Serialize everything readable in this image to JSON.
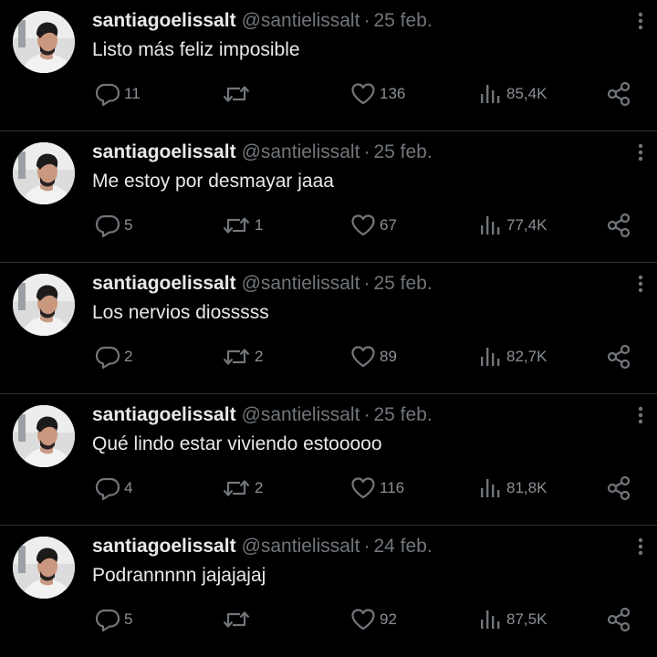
{
  "tweets": [
    {
      "name": "santiagoelissalt",
      "handle": "@santielissalt",
      "separator": "·",
      "date": "25 feb.",
      "text": "Listo más feliz imposible",
      "replies": "11",
      "retweets": "",
      "likes": "136",
      "views": "85,4K"
    },
    {
      "name": "santiagoelissalt",
      "handle": "@santielissalt",
      "separator": "·",
      "date": "25 feb.",
      "text": "Me estoy por desmayar jaaa",
      "replies": "5",
      "retweets": "1",
      "likes": "67",
      "views": "77,4K"
    },
    {
      "name": "santiagoelissalt",
      "handle": "@santielissalt",
      "separator": "·",
      "date": "25 feb.",
      "text": "Los nervios diosssss",
      "replies": "2",
      "retweets": "2",
      "likes": "89",
      "views": "82,7K"
    },
    {
      "name": "santiagoelissalt",
      "handle": "@santielissalt",
      "separator": "·",
      "date": "25 feb.",
      "text": "Qué lindo estar viviendo estooooo",
      "replies": "4",
      "retweets": "2",
      "likes": "116",
      "views": "81,8K"
    },
    {
      "name": "santiagoelissalt",
      "handle": "@santielissalt",
      "separator": "·",
      "date": "24 feb.",
      "text": "Podrannnnn jajajajaj",
      "replies": "5",
      "retweets": "",
      "likes": "92",
      "views": "87,5K"
    }
  ],
  "icons": {
    "reply": "reply-icon",
    "retweet": "retweet-icon",
    "like": "heart-icon",
    "views": "views-icon",
    "share": "share-icon",
    "more": "more-icon"
  },
  "colors": {
    "background": "#000000",
    "text": "#e7e9ea",
    "muted": "#71767b",
    "divider": "#2f3336"
  }
}
